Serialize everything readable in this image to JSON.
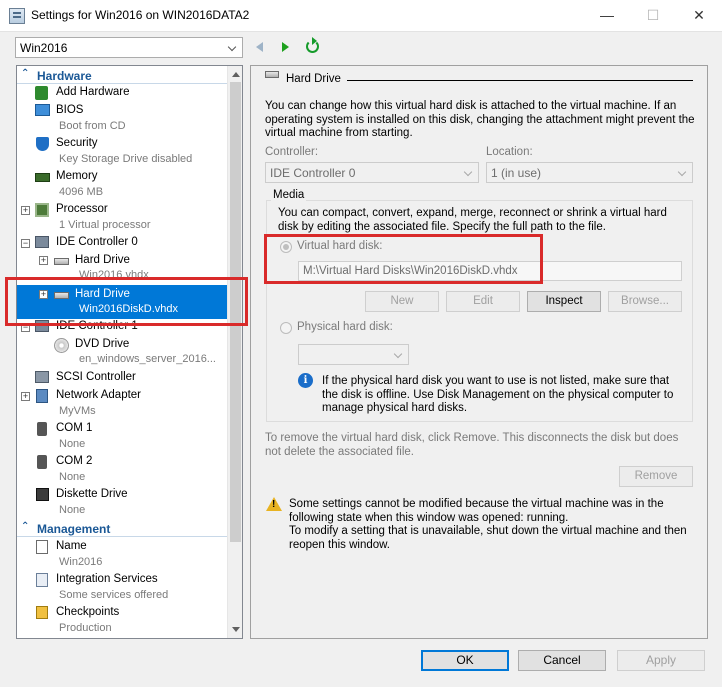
{
  "window": {
    "title": "Settings for Win2016 on WIN2016DATA2",
    "minimize": "—",
    "maximize": "☐",
    "close": "✕"
  },
  "vm_selector": {
    "value": "Win2016"
  },
  "tree": {
    "hardware_header": "Hardware",
    "management_header": "Management",
    "items": {
      "add_hardware": {
        "label": "Add Hardware"
      },
      "bios": {
        "label": "BIOS",
        "sub": "Boot from CD"
      },
      "security": {
        "label": "Security",
        "sub": "Key Storage Drive disabled"
      },
      "memory": {
        "label": "Memory",
        "sub": "4096 MB"
      },
      "processor": {
        "label": "Processor",
        "sub": "1 Virtual processor"
      },
      "ide0": {
        "label": "IDE Controller 0"
      },
      "hd1": {
        "label": "Hard Drive",
        "sub": "Win2016.vhdx"
      },
      "hd2": {
        "label": "Hard Drive",
        "sub": "Win2016DiskD.vhdx"
      },
      "ide1": {
        "label": "IDE Controller 1"
      },
      "dvd": {
        "label": "DVD Drive",
        "sub": "en_windows_server_2016..."
      },
      "scsi": {
        "label": "SCSI Controller"
      },
      "network": {
        "label": "Network Adapter",
        "sub": "MyVMs"
      },
      "com1": {
        "label": "COM 1",
        "sub": "None"
      },
      "com2": {
        "label": "COM 2",
        "sub": "None"
      },
      "diskette": {
        "label": "Diskette Drive",
        "sub": "None"
      },
      "name": {
        "label": "Name",
        "sub": "Win2016"
      },
      "integration": {
        "label": "Integration Services",
        "sub": "Some services offered"
      },
      "checkpoints": {
        "label": "Checkpoints",
        "sub": "Production"
      }
    }
  },
  "panel": {
    "heading": "Hard Drive",
    "intro": "You can change how this virtual hard disk is attached to the virtual machine. If an operating system is installed on this disk, changing the attachment might prevent the virtual machine from starting.",
    "controller_label": "Controller:",
    "controller_value": "IDE Controller 0",
    "location_label": "Location:",
    "location_value": "1 (in use)",
    "media_label": "Media",
    "media_desc": "You can compact, convert, expand, merge, reconnect or shrink a virtual hard disk by editing the associated file. Specify the full path to the file.",
    "vhd_radio_label": "Virtual hard disk:",
    "vhd_path": "M:\\Virtual Hard Disks\\Win2016DiskD.vhdx",
    "btn_new": "New",
    "btn_edit": "Edit",
    "btn_inspect": "Inspect",
    "btn_browse": "Browse...",
    "phys_radio_label": "Physical hard disk:",
    "phys_info": "If the physical hard disk you want to use is not listed, make sure that the disk is offline. Use Disk Management on the physical computer to manage physical hard disks.",
    "remove_text": "To remove the virtual hard disk, click Remove. This disconnects the disk but does not delete the associated file.",
    "btn_remove": "Remove",
    "warning_text": "Some settings cannot be modified because the virtual machine was in the following state when this window was opened: running.\nTo modify a setting that is unavailable, shut down the virtual machine and then reopen this window."
  },
  "footer": {
    "ok": "OK",
    "cancel": "Cancel",
    "apply": "Apply"
  }
}
